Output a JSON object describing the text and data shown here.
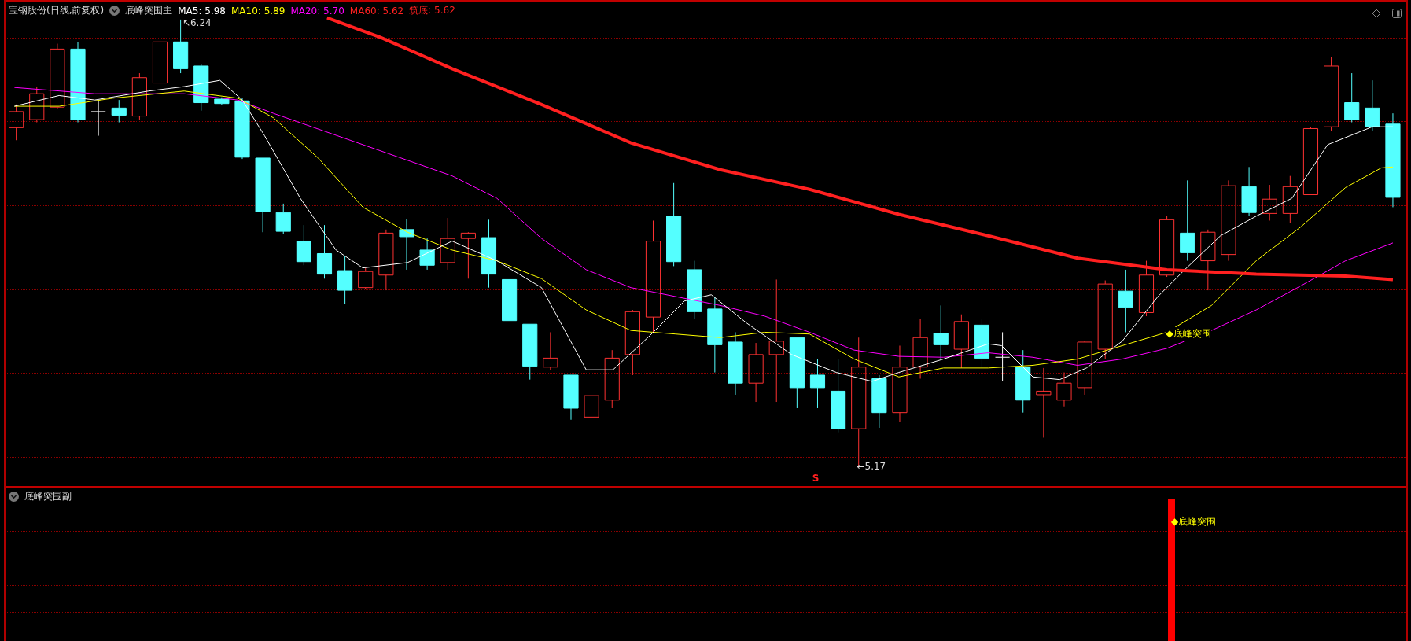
{
  "main_panel": {
    "title": "宝钢股份(日线,前复权)",
    "indicator": "底峰突围主",
    "values": [
      {
        "label": "MA5: 5.98",
        "color": "#ffffff"
      },
      {
        "label": "MA10: 5.89",
        "color": "#ffff00"
      },
      {
        "label": "MA20: 5.70",
        "color": "#ff00ff"
      },
      {
        "label": "MA60: 5.62",
        "color": "#ff2020"
      },
      {
        "label": "筑底: 5.62",
        "color": "#ff2020"
      }
    ],
    "high_marker": "↖6.24",
    "low_marker": "←5.17",
    "signal_mark": "S",
    "signal_label": "◆底峰突围"
  },
  "sub_panel": {
    "indicator": "底峰突围副",
    "signal_label": "◆底峰突围"
  }
}
